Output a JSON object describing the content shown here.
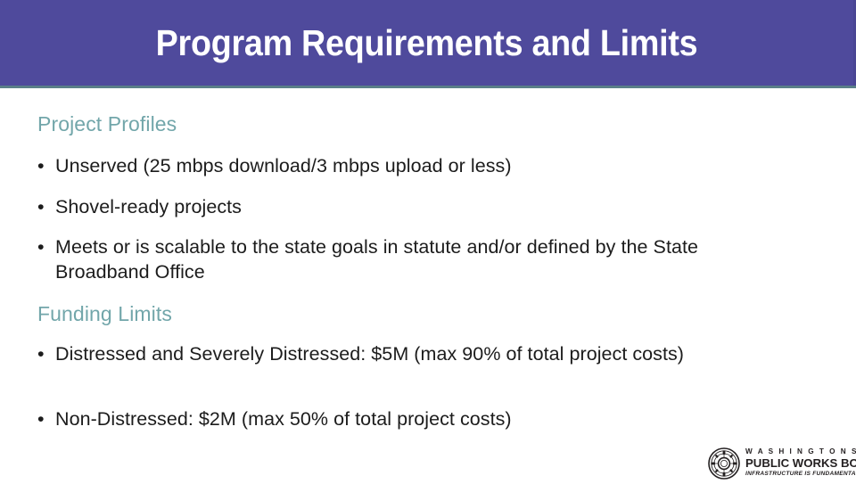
{
  "slide": {
    "title": "Program Requirements and Limits",
    "colors": {
      "banner_purple": "#4f4a9c",
      "banner_underline": "#5a7f89",
      "heading_teal": "#72a6aa",
      "body_text": "#1c1c1c",
      "background": "#ffffff"
    },
    "sections": [
      {
        "heading": "Project Profiles",
        "bullets": [
          {
            "marker": "•",
            "text": "Unserved (25 mbps download/3 mbps upload or less)"
          },
          {
            "marker": "•",
            "text": "Shovel-ready projects"
          },
          {
            "marker": "•",
            "text": "Meets or is scalable to the state goals in statute and/or defined by the State Broadband Office"
          }
        ]
      },
      {
        "heading": "Funding Limits",
        "bullets": [
          {
            "marker": "•",
            "text": "Distressed and Severely Distressed: $5M (max 90% of total project costs)"
          },
          {
            "marker": "•",
            "text": "Non-Distressed: $2M (max 50% of total project costs)"
          }
        ]
      }
    ],
    "logo": {
      "seal_name": "washington-state-seal-icon",
      "line1": "W A S H I N G T O N   S T A T E",
      "line2": "PUBLIC WORKS BOARD",
      "line3": "INFRASTRUCTURE IS FUNDAMENTAL"
    }
  }
}
